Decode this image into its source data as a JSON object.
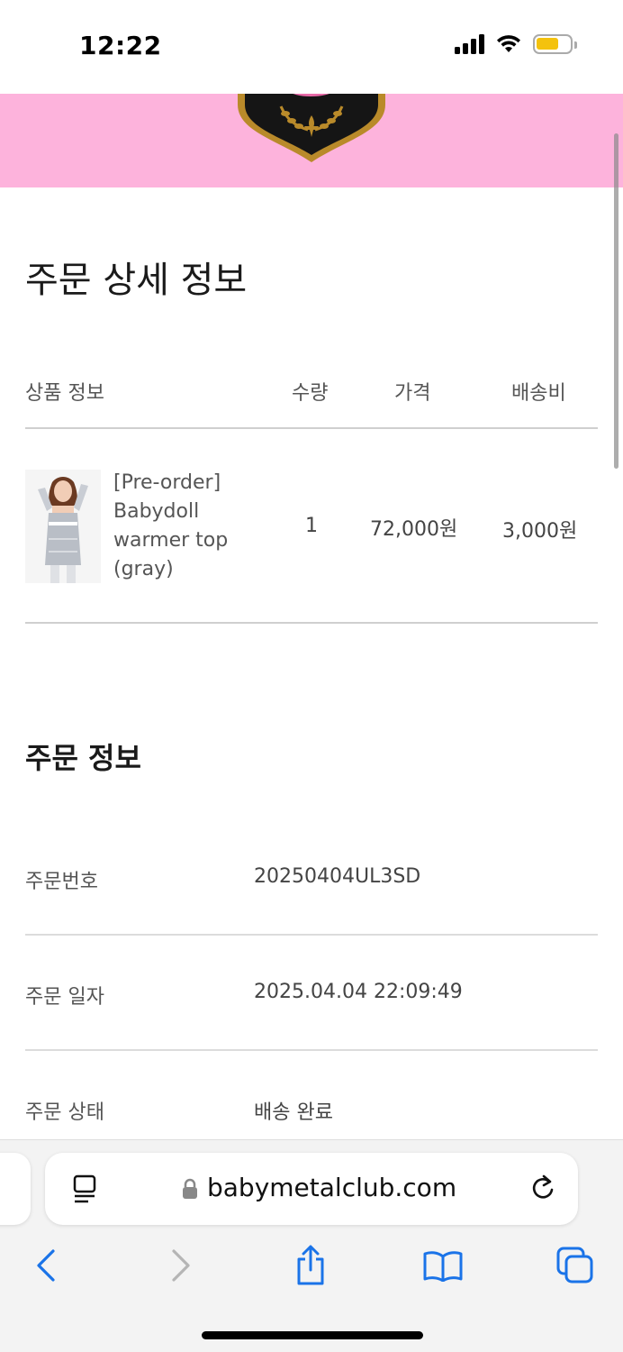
{
  "status_bar": {
    "time": "12:22",
    "icons": [
      "cellular-signal-icon",
      "wifi-icon",
      "battery-icon"
    ],
    "battery_color": "#f4c20d"
  },
  "header": {
    "banner_color": "#fdb3dc",
    "logo": "club-crest-logo"
  },
  "page": {
    "title": "주문 상세 정보"
  },
  "order_table": {
    "headers": {
      "product": "상품 정보",
      "quantity": "수량",
      "price": "가격",
      "shipping": "배송비"
    },
    "items": [
      {
        "name": "[Pre-order] Babydoll warmer top (gray)",
        "quantity": "1",
        "price": "72,000원",
        "shipping": "3,000원"
      }
    ]
  },
  "order_info": {
    "title": "주문 정보",
    "rows": [
      {
        "label": "주문번호",
        "value": "20250404UL3SD"
      },
      {
        "label": "주문 일자",
        "value": "2025.04.04 22:09:49"
      },
      {
        "label": "주문 상태",
        "value": "배송 완료"
      }
    ]
  },
  "browser": {
    "url": "babymetalclub.com",
    "accent_color": "#1a73e8",
    "toolbar": [
      "back-icon",
      "forward-icon",
      "share-icon",
      "bookmarks-icon",
      "tabs-icon"
    ]
  }
}
